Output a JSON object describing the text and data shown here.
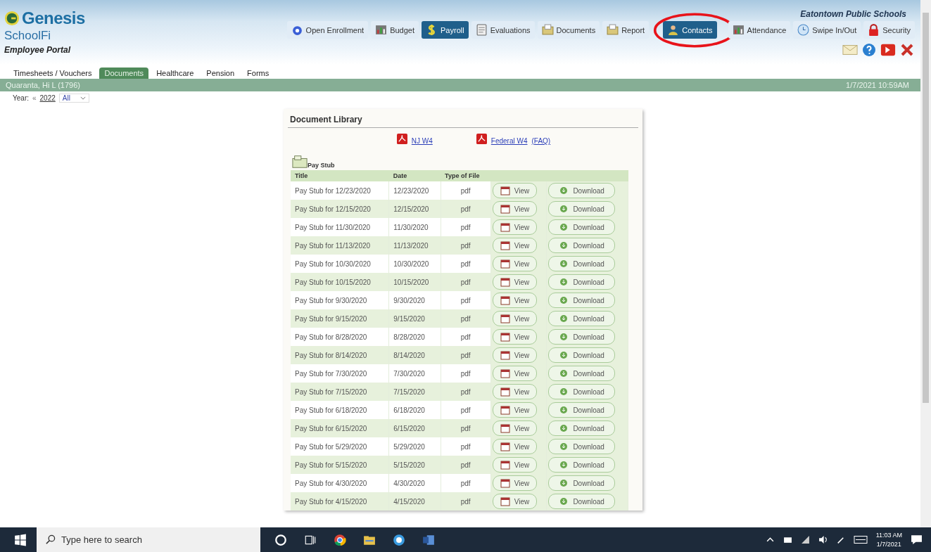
{
  "brand": {
    "logo": "Genesis",
    "product": "SchoolFi",
    "portal": "Employee Portal"
  },
  "school": "Eatontown Public Schools",
  "nav": [
    {
      "label": "Open Enrollment",
      "kind": "enroll",
      "selected": false,
      "circled": false
    },
    {
      "label": "Budget",
      "kind": "chart",
      "selected": false,
      "circled": false
    },
    {
      "label": "Payroll",
      "kind": "dollar",
      "selected": true,
      "circled": false
    },
    {
      "label": "Evaluations",
      "kind": "doc",
      "selected": false,
      "circled": false
    },
    {
      "label": "Documents",
      "kind": "folder",
      "selected": false,
      "circled": false
    },
    {
      "label": "Report",
      "kind": "folder",
      "selected": false,
      "circled": false
    },
    {
      "label": "Contacts",
      "kind": "person",
      "selected": true,
      "circled": true
    },
    {
      "label": "Attendance",
      "kind": "chart",
      "selected": false,
      "circled": false
    },
    {
      "label": "Swipe In/Out",
      "kind": "clock",
      "selected": false,
      "circled": false
    },
    {
      "label": "Security",
      "kind": "lock",
      "selected": false,
      "circled": false
    }
  ],
  "subtabs": [
    {
      "label": "Timesheets / Vouchers",
      "selected": false
    },
    {
      "label": "Documents",
      "selected": true
    },
    {
      "label": "Healthcare",
      "selected": false
    },
    {
      "label": "Pension",
      "selected": false
    },
    {
      "label": "Forms",
      "selected": false
    }
  ],
  "user_bar": {
    "name": "Quaranta, Hi L  (1796)",
    "datetime": "1/7/2021 10:59AM"
  },
  "year_filter": {
    "label": "Year:",
    "prev": "«",
    "year": "2022",
    "select": "All"
  },
  "library": {
    "title": "Document Library",
    "links": [
      {
        "label": "NJ W4"
      },
      {
        "label": "Federal W4",
        "extra": "(FAQ)"
      }
    ],
    "section": "Pay Stub",
    "columns": [
      "Title",
      "Date",
      "Type of File"
    ],
    "rows": [
      {
        "title": "Pay Stub for 12/23/2020",
        "date": "12/23/2020",
        "type": "pdf",
        "view": "View",
        "download": "Download"
      },
      {
        "title": "Pay Stub for 12/15/2020",
        "date": "12/15/2020",
        "type": "pdf",
        "view": "View",
        "download": "Download"
      },
      {
        "title": "Pay Stub for 11/30/2020",
        "date": "11/30/2020",
        "type": "pdf",
        "view": "View",
        "download": "Download"
      },
      {
        "title": "Pay Stub for 11/13/2020",
        "date": "11/13/2020",
        "type": "pdf",
        "view": "View",
        "download": "Download"
      },
      {
        "title": "Pay Stub for 10/30/2020",
        "date": "10/30/2020",
        "type": "pdf",
        "view": "View",
        "download": "Download"
      },
      {
        "title": "Pay Stub for 10/15/2020",
        "date": "10/15/2020",
        "type": "pdf",
        "view": "View",
        "download": "Download"
      },
      {
        "title": "Pay Stub for 9/30/2020",
        "date": "9/30/2020",
        "type": "pdf",
        "view": "View",
        "download": "Download"
      },
      {
        "title": "Pay Stub for 9/15/2020",
        "date": "9/15/2020",
        "type": "pdf",
        "view": "View",
        "download": "Download"
      },
      {
        "title": "Pay Stub for 8/28/2020",
        "date": "8/28/2020",
        "type": "pdf",
        "view": "View",
        "download": "Download"
      },
      {
        "title": "Pay Stub for 8/14/2020",
        "date": "8/14/2020",
        "type": "pdf",
        "view": "View",
        "download": "Download"
      },
      {
        "title": "Pay Stub for 7/30/2020",
        "date": "7/30/2020",
        "type": "pdf",
        "view": "View",
        "download": "Download"
      },
      {
        "title": "Pay Stub for 7/15/2020",
        "date": "7/15/2020",
        "type": "pdf",
        "view": "View",
        "download": "Download"
      },
      {
        "title": "Pay Stub for 6/18/2020",
        "date": "6/18/2020",
        "type": "pdf",
        "view": "View",
        "download": "Download"
      },
      {
        "title": "Pay Stub for 6/15/2020",
        "date": "6/15/2020",
        "type": "pdf",
        "view": "View",
        "download": "Download"
      },
      {
        "title": "Pay Stub for 5/29/2020",
        "date": "5/29/2020",
        "type": "pdf",
        "view": "View",
        "download": "Download"
      },
      {
        "title": "Pay Stub for 5/15/2020",
        "date": "5/15/2020",
        "type": "pdf",
        "view": "View",
        "download": "Download"
      },
      {
        "title": "Pay Stub for 4/30/2020",
        "date": "4/30/2020",
        "type": "pdf",
        "view": "View",
        "download": "Download"
      },
      {
        "title": "Pay Stub for 4/15/2020",
        "date": "4/15/2020",
        "type": "pdf",
        "view": "View",
        "download": "Download"
      }
    ]
  },
  "taskbar": {
    "search_placeholder": "Type here to search",
    "time": "11:03 AM",
    "date": "1/7/2021"
  }
}
